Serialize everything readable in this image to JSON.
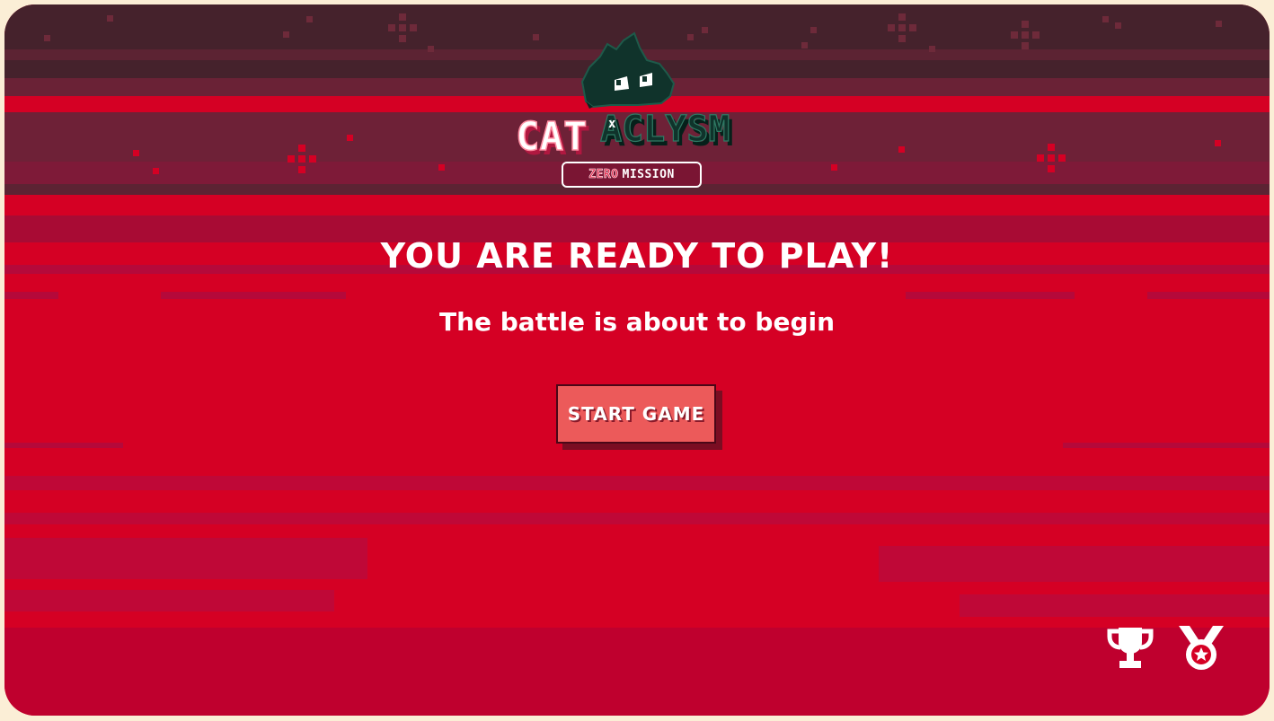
{
  "game": {
    "logo": {
      "word_left": "CAT",
      "word_right": "ACLYSM",
      "x_mark": "x"
    },
    "badge": {
      "zero": "ZERO",
      "mission": "MISSION"
    },
    "headline": "YOU ARE READY TO PLAY!",
    "subtitle": "The battle is about to begin",
    "start_button_label": "START GAME",
    "icons": {
      "leaderboard": "trophy-icon",
      "achievements": "medal-icon"
    }
  },
  "colors": {
    "page_background": "#fbeed6",
    "game_red": "#d50024",
    "top_band_dark": "#45222c",
    "button_fill": "#ec5a5a",
    "logo_dark_green": "#10332b",
    "logo_pink": "#ff8fa3",
    "text_white": "#ffffff"
  }
}
